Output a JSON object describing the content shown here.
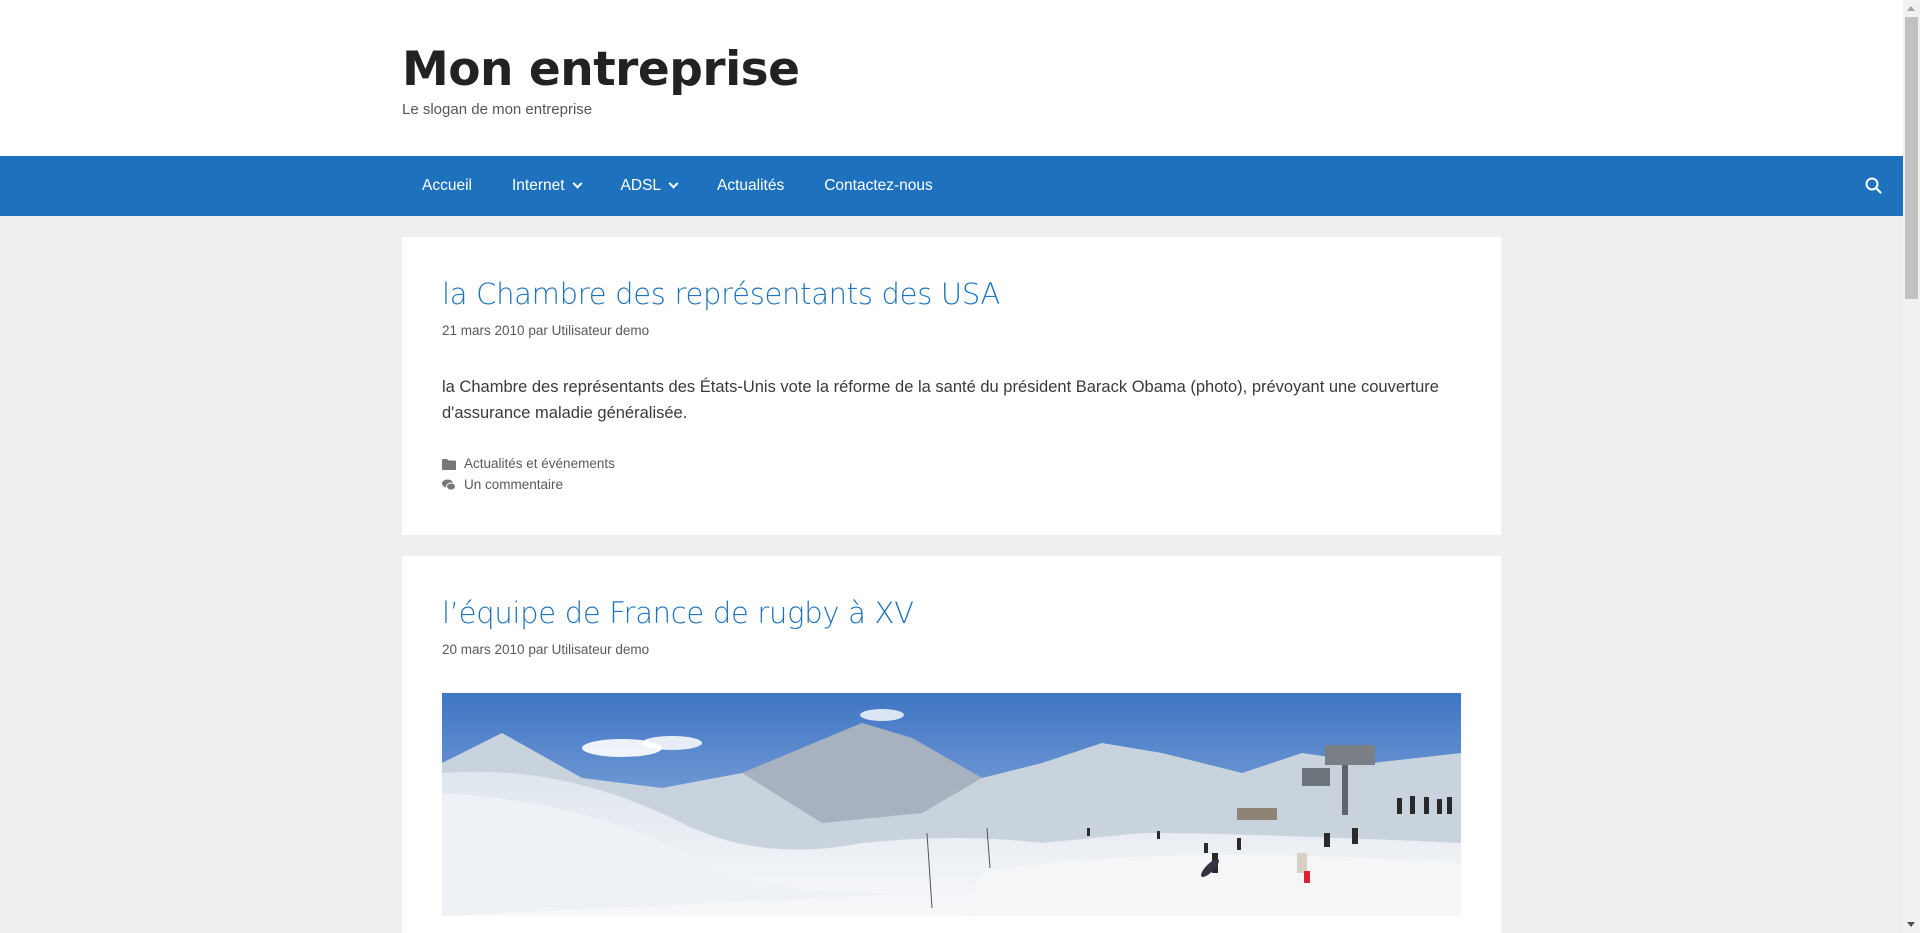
{
  "site": {
    "title": "Mon entreprise",
    "slogan": "Le slogan de mon entreprise"
  },
  "nav": {
    "items": [
      {
        "label": "Accueil",
        "has_dropdown": false
      },
      {
        "label": "Internet",
        "has_dropdown": true
      },
      {
        "label": "ADSL",
        "has_dropdown": true
      },
      {
        "label": "Actualités",
        "has_dropdown": false
      },
      {
        "label": "Contactez-nous",
        "has_dropdown": false
      }
    ],
    "search_icon": "search-icon",
    "color": "#1e72bd"
  },
  "posts": [
    {
      "title": "la Chambre des représentants des USA",
      "date": "21 mars 2010",
      "by": "par",
      "author": "Utilisateur demo",
      "content": "la Chambre des représentants des États-Unis vote la réforme de la santé du président Barack Obama (photo), prévoyant une couverture d'assurance maladie généralisée.",
      "category": "Actualités et événements",
      "comments": "Un commentaire"
    },
    {
      "title": "l’équipe de France de rugby à XV",
      "date": "20 mars 2010",
      "by": "par",
      "author": "Utilisateur demo",
      "image": "snowy-mountain-panorama-with-skiers"
    }
  ],
  "colors": {
    "link": "#1e73be",
    "background": "#efeff1"
  }
}
